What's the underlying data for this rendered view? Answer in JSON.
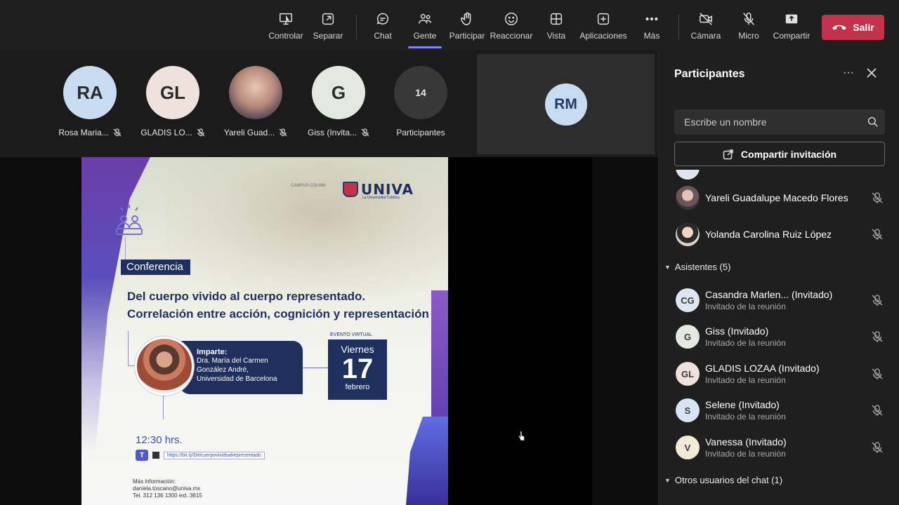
{
  "toolbar": {
    "buttons": [
      {
        "label": "Controlar",
        "icon": "control-icon"
      },
      {
        "label": "Separar",
        "icon": "popout-icon"
      },
      {
        "label": "Chat",
        "icon": "chat-icon"
      },
      {
        "label": "Gente",
        "icon": "people-icon"
      },
      {
        "label": "Participar",
        "icon": "raise-hand-icon"
      },
      {
        "label": "Reaccionar",
        "icon": "smiley-icon"
      },
      {
        "label": "Vista",
        "icon": "view-grid-icon"
      },
      {
        "label": "Aplicaciones",
        "icon": "add-apps-icon"
      },
      {
        "label": "Más",
        "icon": "more-icon"
      },
      {
        "label": "Cámara",
        "icon": "camera-off-icon"
      },
      {
        "label": "Micro",
        "icon": "mic-off-icon"
      },
      {
        "label": "Compartir",
        "icon": "share-icon"
      }
    ],
    "leave_label": "Salir",
    "leave_color": "#c4314b",
    "active_tab_color": "#7f85f5"
  },
  "gallery": {
    "tiles": [
      {
        "initials": "RA",
        "name": "Rosa Maria...",
        "color": "#c7dcf0"
      },
      {
        "initials": "GL",
        "name": "GLADIS LO...",
        "color": "#efe1dc"
      },
      {
        "initials": "",
        "name": "Yareli Guad...",
        "color": "#b98a7c"
      },
      {
        "initials": "G",
        "name": "Giss (Invita...",
        "color": "#e3e8e0"
      }
    ],
    "more": {
      "count": "14",
      "label": "Participantes"
    },
    "featured": {
      "initials": "RM",
      "color": "#c7dcf0"
    }
  },
  "poster": {
    "campus": "CAMPUS COLIMA",
    "brand": "UNIVA",
    "brand_sub": "La Universidad Católica",
    "badge": "Conferencia",
    "title_line1": "Del cuerpo vivido al cuerpo representado.",
    "title_line2": "Correlación entre acción, cognición y representación",
    "speaker_heading": "Imparte:",
    "speaker_line1": "Dra. María del Carmen",
    "speaker_line2": "González André,",
    "speaker_line3": "Universidad de Barcelona",
    "event_label": "EVENTO VIRTUAL",
    "weekday": "Viernes",
    "day": "17",
    "month": "febrero",
    "time": "12:30 hrs.",
    "url": "https://bit.ly/Delcuerpovividoalrepresentado",
    "info_heading": "Más información:",
    "info_email": "daniela.toscano@univa.mx",
    "info_phone": "Tel. 312 136 1300 ext. 3815"
  },
  "panel": {
    "title": "Participantes",
    "search_placeholder": "Escribe un nombre",
    "invite_label": "Compartir invitación",
    "presenters": [
      {
        "name": "Yareli Guadalupe Macedo Flores",
        "initials": "",
        "color": "#b98a7c"
      },
      {
        "name": "Yolanda Carolina Ruiz López",
        "initials": "",
        "color": "#f1d4c2"
      }
    ],
    "attendees_header": "Asistentes (5)",
    "attendees": [
      {
        "name": "Casandra Marlen... (Invitado)",
        "sub": "Invitado de la reunión",
        "initials": "CG",
        "color": "#dfe6f2"
      },
      {
        "name": "Giss (Invitado)",
        "sub": "Invitado de la reunión",
        "initials": "G",
        "color": "#e3e8e0"
      },
      {
        "name": "GLADIS LOZAA (Invitado)",
        "sub": "Invitado de la reunión",
        "initials": "GL",
        "color": "#efe1dc"
      },
      {
        "name": "Selene (Invitado)",
        "sub": "Invitado de la reunión",
        "initials": "S",
        "color": "#d7e4f4"
      },
      {
        "name": "Vanessa (Invitado)",
        "sub": "Invitado de la reunión",
        "initials": "V",
        "color": "#f3ead6"
      }
    ],
    "others_header": "Otros usuarios del chat (1)"
  }
}
